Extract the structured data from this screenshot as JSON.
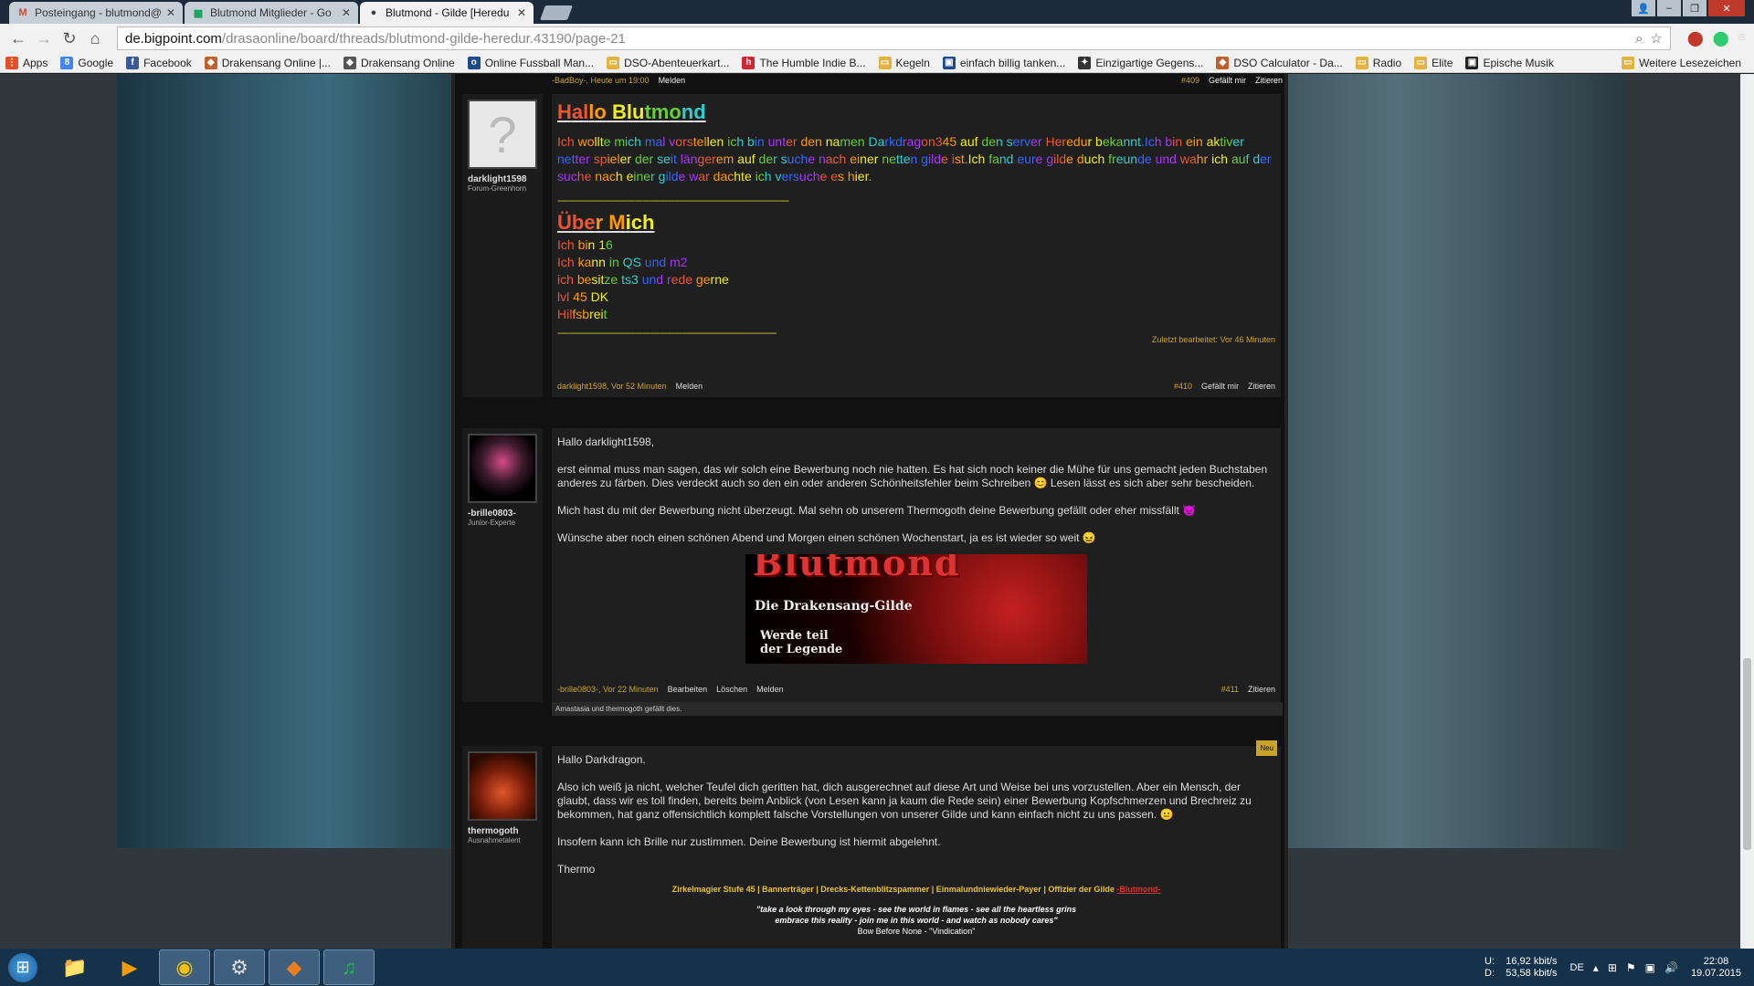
{
  "browser": {
    "tabs": [
      {
        "label": "Posteingang - blutmond@",
        "icon": "M",
        "icon_color": "#d44638",
        "active": false
      },
      {
        "label": "Blutmond Mitglieder - Go",
        "icon": "▦",
        "icon_color": "#0f9d58",
        "active": false
      },
      {
        "label": "Blutmond - Gilde [Heredu",
        "icon": "●",
        "icon_color": "#444444",
        "active": true
      }
    ],
    "url_domain": "de.bigpoint.com",
    "url_path": "/drasaonline/board/threads/blutmond-gilde-heredur.43190/page-21",
    "bookmarks": [
      {
        "label": "Apps",
        "icon": "⋮⋮",
        "color": "#e0502a"
      },
      {
        "label": "Google",
        "icon": "8",
        "color": "#4285f4"
      },
      {
        "label": "Facebook",
        "icon": "f",
        "color": "#3b5998"
      },
      {
        "label": "Drakensang Online |...",
        "icon": "◆",
        "color": "#c0612b"
      },
      {
        "label": "Drakensang Online",
        "icon": "◆",
        "color": "#555555"
      },
      {
        "label": "Online Fussball Man...",
        "icon": "ofm",
        "color": "#1a4b8c"
      },
      {
        "label": "DSO-Abenteuerkart...",
        "icon": "▭",
        "color": "#e3b341"
      },
      {
        "label": "The Humble Indie B...",
        "icon": "h",
        "color": "#cc2936"
      },
      {
        "label": "Kegeln",
        "icon": "▭",
        "color": "#e3b341"
      },
      {
        "label": "einfach billig tanken...",
        "icon": "▣",
        "color": "#1a4b8c"
      },
      {
        "label": "Einzigartige Gegens...",
        "icon": "✦",
        "color": "#333333"
      },
      {
        "label": "DSO Calculator - Da...",
        "icon": "◆",
        "color": "#c0612b"
      },
      {
        "label": "Radio",
        "icon": "▭",
        "color": "#e3b341"
      },
      {
        "label": "Elite",
        "icon": "▭",
        "color": "#e3b341"
      },
      {
        "label": "Epische Musik",
        "icon": "▣",
        "color": "#222222"
      }
    ],
    "more_bookmarks": "Weitere Lesezeichen"
  },
  "posts": {
    "top_bar": {
      "author": "-BadBoy-, Heute um 19:00",
      "report": "Melden",
      "number": "#409",
      "like": "Gefällt mir",
      "quote": "Zitieren"
    },
    "post1": {
      "username": "darklight1598",
      "rank": "Forum-Greenhorn",
      "heading1": "Hallo Blutmond",
      "paragraph1": "Ich wollte mich mal vorstellen ich bin unter den namen Darkdragon345 auf den server Heredur bekannt.Ich bin ein aktiver netter spieler der seit längerem auf der suche nach einer netten gilde ist.Ich fand eure gilde duch freunde und wahr ich auf der suche nach einer gilde war dachte ich versuche es hier.",
      "divider": "-----------------------------------------------------------------------------------------------",
      "heading2": "Über Mich",
      "lines": [
        "Ich bin 16",
        "Ich kann in QS und m2",
        "ich besitze ts3 und rede gerne",
        "lvl 45 DK",
        "Hilfsbreit"
      ],
      "divider2": "------------------------------------------------------------------------------------------",
      "edited": "Zuletzt bearbeitet: Vor 46 Minuten",
      "footer_author": "darklight1598, Vor 52 Minuten",
      "footer_report": "Melden",
      "number": "#410",
      "like": "Gefällt mir",
      "quote": "Zitieren"
    },
    "post2": {
      "username": "-brille0803-",
      "rank": "Junior-Experte",
      "greeting": "Hallo darklight1598,",
      "p1": "erst einmal muss man sagen, das wir solch eine Bewerbung noch nie hatten. Es hat sich noch keiner die Mühe für uns gemacht jeden Buchstaben anderes zu färben. Dies verdeckt auch so den ein oder anderen Schönheitsfehler beim Schreiben 😊 Lesen lässt es sich aber sehr bescheiden.",
      "p2": "Mich hast du mit der Bewerbung nicht überzeugt. Mal sehn ob unserem Thermogoth deine Bewerbung gefällt oder eher missfällt 😈",
      "p3": "Wünsche aber noch einen schönen Abend und Morgen einen schönen Wochenstart, ja es ist wieder so weit 😖",
      "banner_title": "Blutmond",
      "banner_sub": "Die Drakensang-Gilde",
      "banner_slogan1": "Werde teil",
      "banner_slogan2": "der Legende",
      "footer_author": "-brille0803-, Vor 22 Minuten",
      "edit": "Bearbeiten",
      "delete": "Löschen",
      "report": "Melden",
      "number": "#411",
      "quote": "Zitieren",
      "likes": "Amastasia und thermogoth gefällt dies."
    },
    "post3": {
      "username": "thermogoth",
      "rank": "Ausnahmetalent",
      "new_badge": "Neu",
      "greeting": "Hallo Darkdragon.",
      "p1": "Also ich weiß ja nicht, welcher Teufel dich geritten hat, dich ausgerechnet auf diese Art und Weise bei uns vorzustellen. Aber ein Mensch, der glaubt, dass wir es toll finden, bereits beim Anblick (von Lesen kann ja kaum die Rede sein) einer Bewerbung Kopfschmerzen und Brechreiz zu bekommen, hat ganz offensichtlich komplett falsche Vorstellungen von unserer Gilde und kann einfach nicht zu uns passen. 😐",
      "p2": "Insofern kann ich Brille nur zustimmen. Deine Bewerbung ist hiermit abgelehnt.",
      "sign": "Thermo",
      "sig_line": "Zirkelmagier Stufe 45 | Bannerträger | Drecks-Kettenblitzspammer | Einmalundniewieder-Payer | Offizier der Gilde",
      "sig_guild": "-Blutmond-",
      "sig_quote1": "\"take a look through my eyes - see the world in flames - see all the heartless grins",
      "sig_quote2": "embrace this reality - join me in this world - and watch as nobody cares\"",
      "sig_quote3": "Bow Before None - \"Vindication\""
    }
  },
  "taskbar": {
    "apps": [
      {
        "name": "explorer",
        "icon": "📁"
      },
      {
        "name": "media",
        "icon": "▶"
      },
      {
        "name": "chrome",
        "icon": "◉"
      },
      {
        "name": "steam",
        "icon": "⚙"
      },
      {
        "name": "drakensang",
        "icon": "◆"
      },
      {
        "name": "spotify",
        "icon": "♫"
      }
    ],
    "net_up": "16,92 kbit/s",
    "net_down": "53,58 kbit/s",
    "net_up_label": "U:",
    "net_down_label": "D:",
    "lang": "DE",
    "time": "22:08",
    "date": "19.07.2015"
  }
}
